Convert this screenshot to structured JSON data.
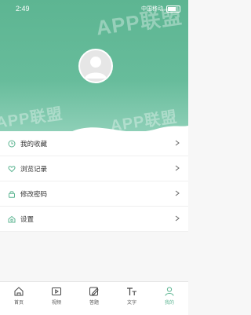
{
  "status_bar": {
    "time": "2:49",
    "carrier": "中国移动"
  },
  "watermark": "APP联盟",
  "menu": [
    {
      "label": "我的收藏",
      "icon": "clock-icon"
    },
    {
      "label": "浏览记录",
      "icon": "heart-icon"
    },
    {
      "label": "修改密码",
      "icon": "lock-icon"
    },
    {
      "label": "设置",
      "icon": "home-gear-icon"
    }
  ],
  "tabs": [
    {
      "label": "首页",
      "icon": "home-icon"
    },
    {
      "label": "视频",
      "icon": "video-icon"
    },
    {
      "label": "答题",
      "icon": "pen-icon"
    },
    {
      "label": "文字",
      "icon": "text-icon"
    },
    {
      "label": "我的",
      "icon": "user-icon",
      "active": true
    }
  ],
  "colors": {
    "accent": "#5db592"
  }
}
